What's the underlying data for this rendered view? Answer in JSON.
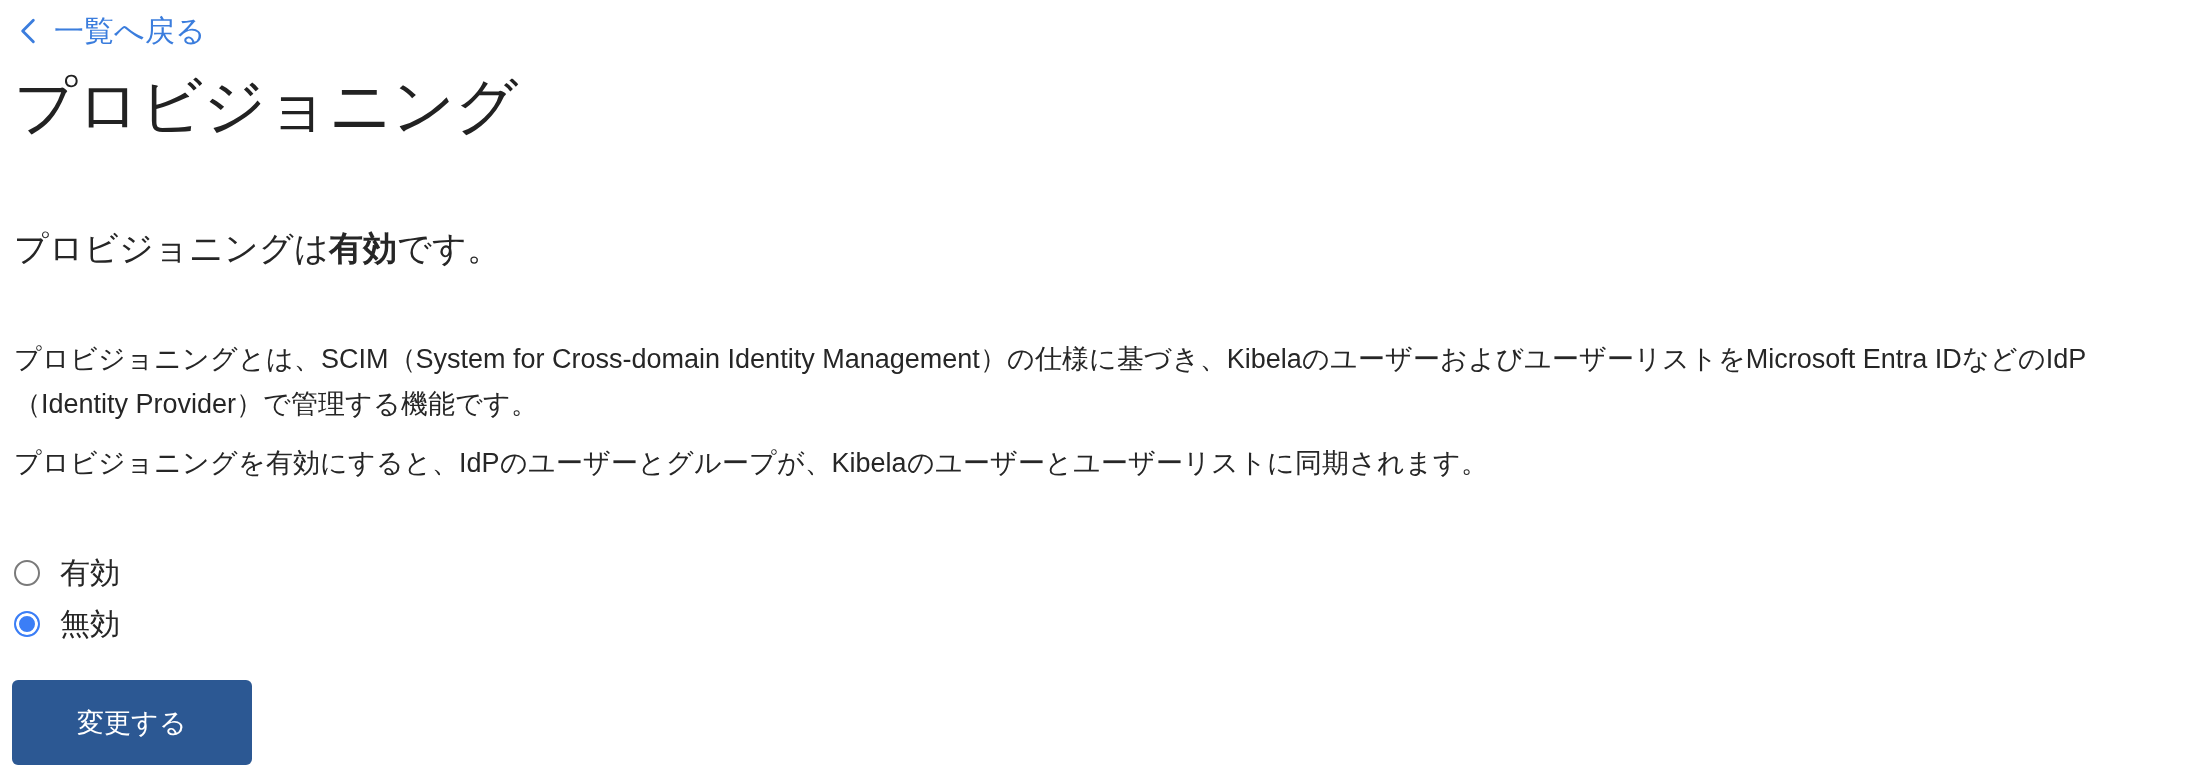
{
  "back_link": {
    "label": "一覧へ戻る"
  },
  "title": "プロビジョニング",
  "status": "プロビジョニングは**有効**です。",
  "description": [
    "プロビジョニングとは、SCIM（System for Cross-domain Identity Management）の仕様に基づき、KibelaのユーザーおよびユーザーリストをMicrosoft Entra IDなどのIdP（Identity Provider）で管理する機能です。",
    "プロビジョニングを有効にすると、IdPのユーザーとグループが、Kibelaのユーザーとユーザーリストに同期されます。"
  ],
  "options": [
    {
      "label": "有効",
      "selected": false
    },
    {
      "label": "無効",
      "selected": true
    }
  ],
  "submit_button": {
    "label": "変更する"
  }
}
